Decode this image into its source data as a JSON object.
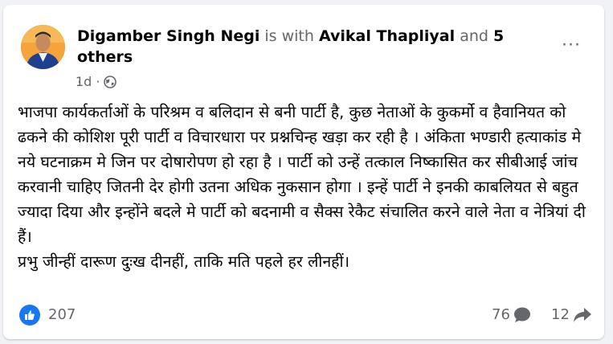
{
  "post": {
    "author": "Digamber Singh Negi",
    "is_with": "is with",
    "tagged": "Avikal Thapliyal",
    "and": "and",
    "others": "5 others",
    "trailing": ".",
    "time": "1d",
    "separator": "·",
    "privacy_icon": "globe-icon",
    "more_label": "···",
    "body": [
      "भाजपा कार्यकर्ताओं के परिश्रम व बलिदान से बनी पार्टी है, कुछ नेताओं के कुकर्मो व हैवानियत को ढकने की  कोशिश पूरी पार्टी व विचारधारा पर प्रश्नचिन्ह खड़ा कर रही है । अंकिता  भण्डारी हत्याकांड मे नये घटनाक्रम मे जिन पर दोषारोपण हो रहा है । पार्टी को उन्हें तत्काल निष्कासित कर सीबीआई जांच करवानी चाहिए जितनी देर होगी उतना अधिक नुकसान होगा । इन्हें पार्टी ने इनकी काबलियत से बहुत ज्यादा दिया और इन्होंने बदले मे पार्टी को बदनामी व सैक्स रेकैट संचालित करने वाले नेता व नेत्रियां दी हैं।",
      "प्रभु जीन्हीं दारूण दुःख दीनहीं, ताकि मति पहले हर लीनहीं।"
    ],
    "likes": "207",
    "comments": "76",
    "shares": "12"
  },
  "colors": {
    "like_blue": "#1877f2",
    "secondary_text": "#65676b",
    "primary_text": "#050505"
  }
}
